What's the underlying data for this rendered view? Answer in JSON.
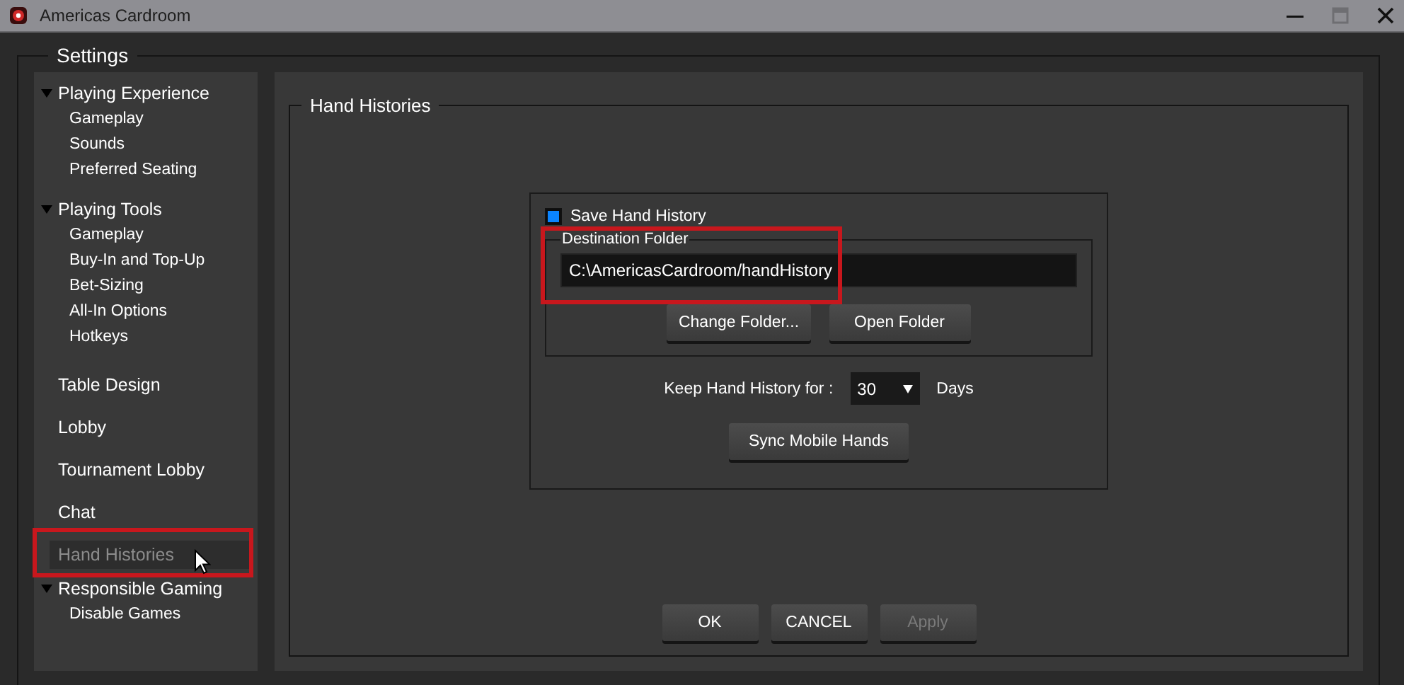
{
  "window": {
    "title": "Americas Cardroom"
  },
  "settings": {
    "title": "Settings"
  },
  "sidebar": {
    "items": [
      {
        "label": "Playing Experience",
        "expanded": true,
        "children": [
          {
            "label": "Gameplay",
            "selected": false
          },
          {
            "label": "Sounds",
            "selected": false
          },
          {
            "label": "Preferred Seating",
            "selected": false
          }
        ]
      },
      {
        "label": "Playing Tools",
        "expanded": true,
        "children": [
          {
            "label": "Gameplay",
            "selected": false
          },
          {
            "label": "Buy-In and Top-Up",
            "selected": false
          },
          {
            "label": "Bet-Sizing",
            "selected": false
          },
          {
            "label": "All-In Options",
            "selected": false
          },
          {
            "label": "Hotkeys",
            "selected": false
          }
        ]
      },
      {
        "label": "Table Design",
        "selected": false
      },
      {
        "label": "Lobby",
        "selected": false
      },
      {
        "label": "Tournament Lobby",
        "selected": false
      },
      {
        "label": "Chat",
        "selected": false
      },
      {
        "label": "Hand Histories",
        "selected": true,
        "highlighted": true,
        "hovered": true
      },
      {
        "label": "Responsible Gaming",
        "expanded": true,
        "children": [
          {
            "label": "Disable Games",
            "selected": false
          }
        ]
      }
    ]
  },
  "panel": {
    "title": "Hand Histories",
    "save_hand_history": {
      "label": "Save Hand History",
      "checked": true
    },
    "destination_folder": {
      "title": "Destination Folder",
      "value": "C:\\AmericasCardroom/handHistory",
      "highlighted": true,
      "buttons": [
        "Change Folder...",
        "Open Folder"
      ]
    },
    "keep": {
      "label": "Keep Hand History for :",
      "value": "30",
      "unit": "Days"
    },
    "sync_button": "Sync Mobile Hands"
  },
  "footer_buttons": [
    {
      "label": "OK",
      "disabled": false
    },
    {
      "label": "CANCEL",
      "disabled": false
    },
    {
      "label": "Apply",
      "disabled": true
    }
  ]
}
